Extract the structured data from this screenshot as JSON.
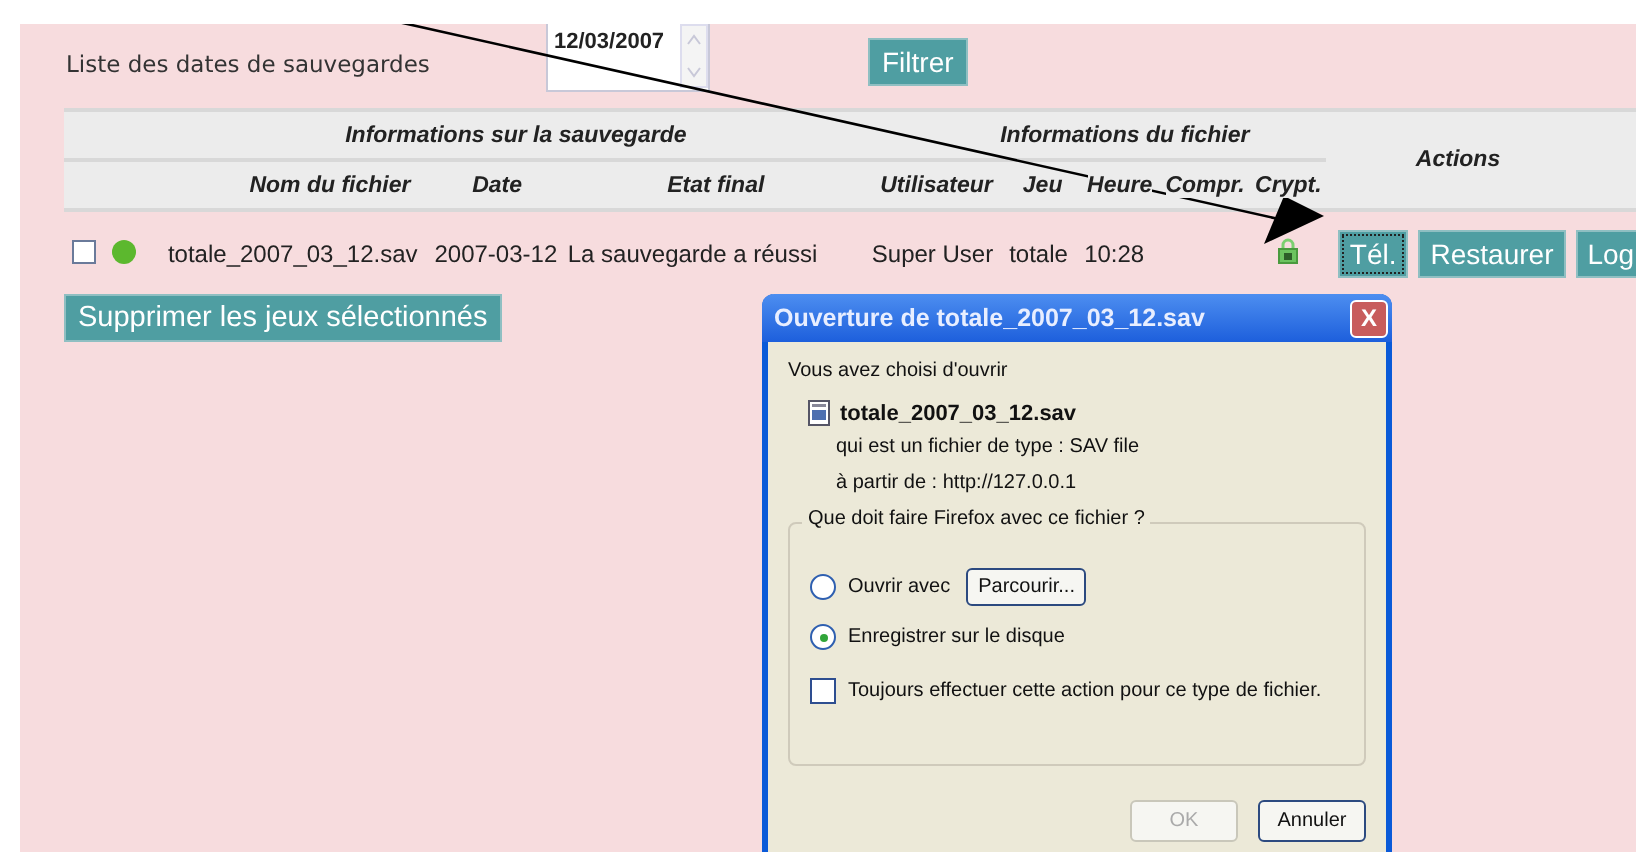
{
  "filter": {
    "label": "Liste des dates de sauvegardes",
    "dates": [
      "12/03/2007"
    ],
    "button": "Filtrer"
  },
  "table": {
    "group_headers": [
      "Informations sur la sauvegarde",
      "Informations du fichier",
      "Actions"
    ],
    "columns": [
      "Nom du fichier",
      "Date",
      "Etat final",
      "Utilisateur",
      "Jeu",
      "Heure",
      "Compr.",
      "Crypt."
    ],
    "rows": [
      {
        "checked": false,
        "color": "#5cb82e",
        "file": "totale_2007_03_12.sav",
        "date": "2007-03-12",
        "status": "La sauvegarde a réussi",
        "user": "Super User",
        "set": "totale",
        "time": "10:28",
        "encrypted": true,
        "actions": [
          "Tél.",
          "Restaurer",
          "Log"
        ]
      }
    ]
  },
  "delete_button": "Supprimer les jeux sélectionnés",
  "dialog": {
    "title": "Ouverture de totale_2007_03_12.sav",
    "close": "X",
    "intro": "Vous avez choisi d'ouvrir",
    "file": "totale_2007_03_12.sav",
    "type_line": "qui est un fichier de type :  SAV file",
    "from_line": "à partir de :  http://127.0.0.1",
    "group": "Que doit faire Firefox avec ce fichier ?",
    "options": [
      {
        "label": "Ouvrir avec",
        "selected": false,
        "button": "Parcourir..."
      },
      {
        "label": "Enregistrer sur le disque",
        "selected": true
      }
    ],
    "always": {
      "label": "Toujours effectuer cette action pour ce type de fichier.",
      "checked": false
    },
    "buttons": [
      {
        "label": "OK",
        "disabled": true
      },
      {
        "label": "Annuler",
        "disabled": false
      }
    ]
  }
}
